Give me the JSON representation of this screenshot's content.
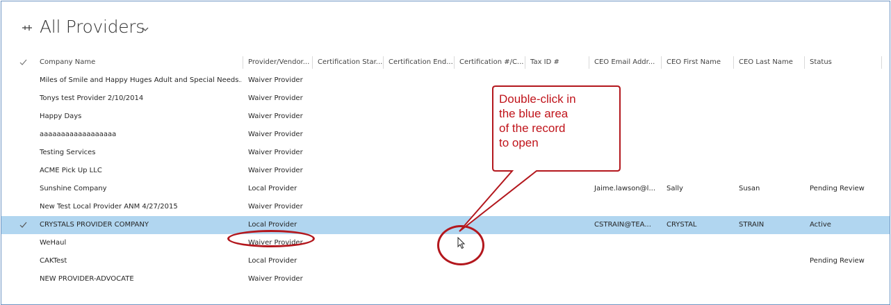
{
  "header": {
    "title": "All Providers"
  },
  "grid": {
    "columns": [
      "Company Name",
      "Provider/Vendor...",
      "Certification Star...",
      "Certification End...",
      "Certification #/C...",
      "Tax ID #",
      "CEO Email Addr...",
      "CEO First Name",
      "CEO Last Name",
      "Status"
    ],
    "rows": [
      {
        "company": "Miles of Smile and Happy Huges Adult and Special Needs...",
        "type": "Waiver Provider",
        "email": "",
        "first": "",
        "last": "",
        "status": ""
      },
      {
        "company": "Tonys test Provider 2/10/2014",
        "type": "Waiver Provider",
        "email": "",
        "first": "",
        "last": "",
        "status": ""
      },
      {
        "company": "Happy Days",
        "type": "Waiver Provider",
        "email": "",
        "first": "",
        "last": "",
        "status": ""
      },
      {
        "company": "aaaaaaaaaaaaaaaaaa",
        "type": "Waiver Provider",
        "email": "",
        "first": "",
        "last": "",
        "status": ""
      },
      {
        "company": "Testing Services",
        "type": "Waiver Provider",
        "email": "",
        "first": "",
        "last": "",
        "status": ""
      },
      {
        "company": "ACME Pick Up LLC",
        "type": "Waiver Provider",
        "email": "",
        "first": "",
        "last": "",
        "status": ""
      },
      {
        "company": "Sunshine Company",
        "type": "Local Provider",
        "email": "Jaime.lawson@l...",
        "first": "Sally",
        "last": "Susan",
        "status": "Pending Review"
      },
      {
        "company": "New Test Local Provider ANM 4/27/2015",
        "type": "Waiver Provider",
        "email": "",
        "first": "",
        "last": "",
        "status": ""
      },
      {
        "company": "CRYSTALS PROVIDER COMPANY",
        "type": "Local Provider",
        "email": "CSTRAIN@TEA...",
        "first": "CRYSTAL",
        "last": "STRAIN",
        "status": "Active",
        "selected": true
      },
      {
        "company": "WeHaul",
        "type": "Waiver Provider",
        "email": "",
        "first": "",
        "last": "",
        "status": ""
      },
      {
        "company": "CAKTest",
        "type": "Local Provider",
        "email": "",
        "first": "",
        "last": "",
        "status": "Pending Review"
      },
      {
        "company": "NEW PROVIDER-ADVOCATE",
        "type": "Waiver Provider",
        "email": "",
        "first": "",
        "last": "",
        "status": ""
      }
    ]
  },
  "annotation": {
    "callout": "Double-click in\nthe blue area\nof the record\nto open",
    "color": "#c0141b"
  },
  "colors": {
    "selected_row": "#b1d6f0",
    "frame_border": "#6d93c2"
  }
}
